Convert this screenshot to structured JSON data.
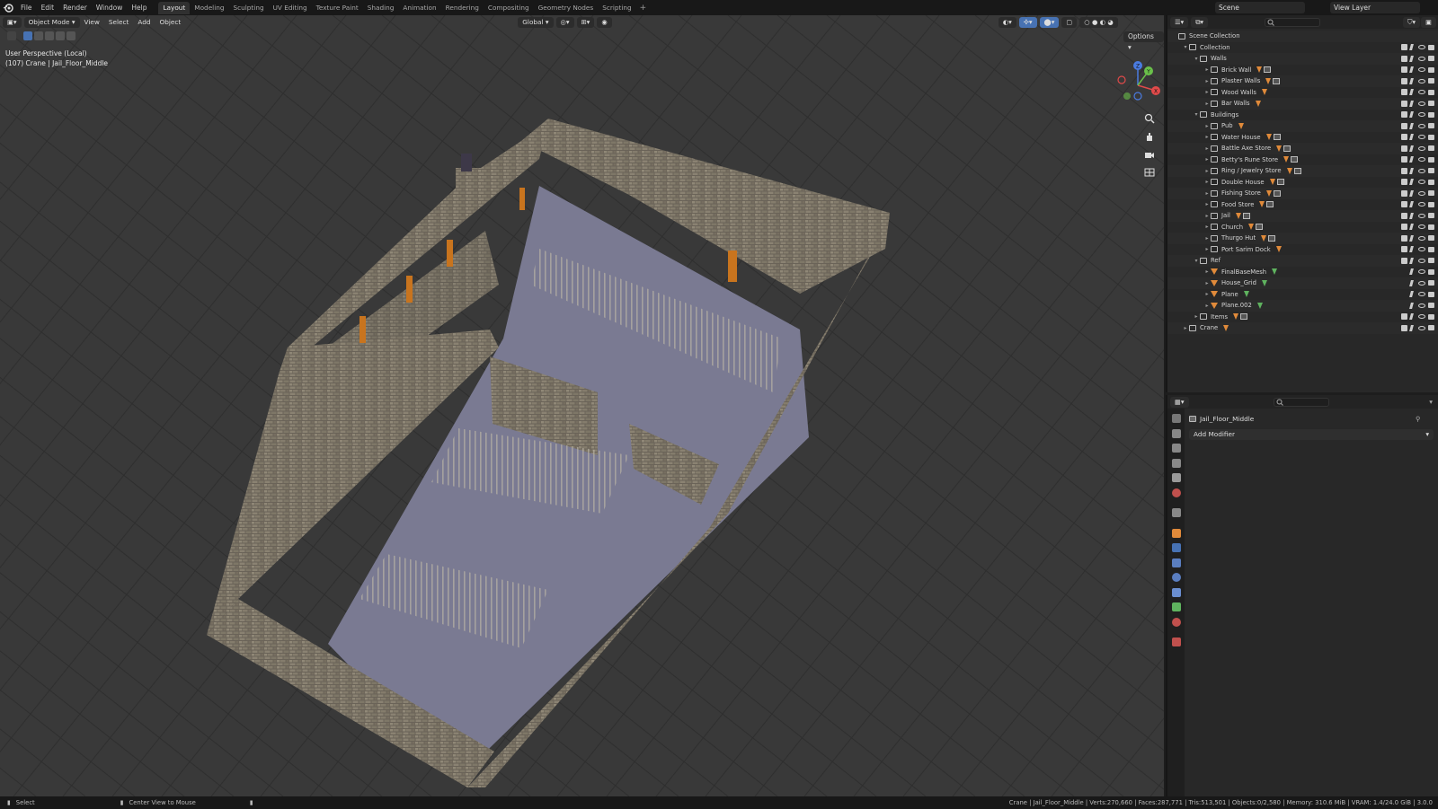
{
  "menu": [
    "File",
    "Edit",
    "Render",
    "Window",
    "Help"
  ],
  "workspaces": [
    "Layout",
    "Modeling",
    "Sculpting",
    "UV Editing",
    "Texture Paint",
    "Shading",
    "Animation",
    "Rendering",
    "Compositing",
    "Geometry Nodes",
    "Scripting"
  ],
  "active_workspace": "Layout",
  "scene_name": "Scene",
  "view_layer": "View Layer",
  "viewport": {
    "mode": "Object Mode",
    "menus": [
      "View",
      "Select",
      "Add",
      "Object"
    ],
    "transform_orientation": "Global",
    "options": "Options",
    "perspective": "User Perspective (Local)",
    "active_object": "(107) Crane | Jail_Floor_Middle",
    "gizmo_axes": {
      "z": "Z",
      "y": "Y",
      "x": "X"
    }
  },
  "outliner": {
    "root": "Scene Collection",
    "rows": [
      {
        "label": "Collection",
        "depth": 1,
        "kind": "collection",
        "open": true,
        "badges": [],
        "checkbox": true
      },
      {
        "label": "Walls",
        "depth": 2,
        "kind": "collection",
        "open": true,
        "badges": [],
        "checkbox": true
      },
      {
        "label": "Brick Wall",
        "depth": 3,
        "kind": "collection",
        "open": false,
        "badges": [
          "orange",
          "img"
        ],
        "checkbox": true
      },
      {
        "label": "Plaster Walls",
        "depth": 3,
        "kind": "collection",
        "open": false,
        "badges": [
          "orange",
          "img"
        ],
        "checkbox": true
      },
      {
        "label": "Wood Walls",
        "depth": 3,
        "kind": "collection",
        "open": false,
        "badges": [
          "orange"
        ],
        "checkbox": true
      },
      {
        "label": "Bar Walls",
        "depth": 3,
        "kind": "collection",
        "open": false,
        "badges": [
          "orange"
        ],
        "checkbox": true
      },
      {
        "label": "Buildings",
        "depth": 2,
        "kind": "collection",
        "open": true,
        "badges": [],
        "checkbox": true
      },
      {
        "label": "Pub",
        "depth": 3,
        "kind": "collection",
        "open": false,
        "badges": [
          "orange"
        ],
        "checkbox": true
      },
      {
        "label": "Water House",
        "depth": 3,
        "kind": "collection",
        "open": false,
        "badges": [
          "orange",
          "img"
        ],
        "checkbox": true
      },
      {
        "label": "Battle Axe Store",
        "depth": 3,
        "kind": "collection",
        "open": false,
        "badges": [
          "orange",
          "img"
        ],
        "checkbox": true
      },
      {
        "label": "Betty's Rune Store",
        "depth": 3,
        "kind": "collection",
        "open": false,
        "badges": [
          "orange",
          "img"
        ],
        "checkbox": true
      },
      {
        "label": "Ring / Jewelry Store",
        "depth": 3,
        "kind": "collection",
        "open": false,
        "badges": [
          "orange",
          "img"
        ],
        "checkbox": true
      },
      {
        "label": "Double House",
        "depth": 3,
        "kind": "collection",
        "open": false,
        "badges": [
          "orange",
          "img"
        ],
        "checkbox": true
      },
      {
        "label": "Fishing Store",
        "depth": 3,
        "kind": "collection",
        "open": false,
        "badges": [
          "orange",
          "img"
        ],
        "checkbox": true
      },
      {
        "label": "Food Store",
        "depth": 3,
        "kind": "collection",
        "open": false,
        "badges": [
          "orange",
          "img"
        ],
        "checkbox": true
      },
      {
        "label": "Jail",
        "depth": 3,
        "kind": "collection",
        "open": false,
        "badges": [
          "orange",
          "img"
        ],
        "checkbox": true
      },
      {
        "label": "Church",
        "depth": 3,
        "kind": "collection",
        "open": false,
        "badges": [
          "orange",
          "img"
        ],
        "checkbox": true
      },
      {
        "label": "Thurgo Hut",
        "depth": 3,
        "kind": "collection",
        "open": false,
        "badges": [
          "orange",
          "img"
        ],
        "checkbox": true
      },
      {
        "label": "Port Sarim Dock",
        "depth": 3,
        "kind": "collection",
        "open": false,
        "badges": [
          "orange"
        ],
        "checkbox": true
      },
      {
        "label": "Ref",
        "depth": 2,
        "kind": "collection",
        "open": true,
        "badges": [],
        "checkbox": true
      },
      {
        "label": "FinalBaseMesh",
        "depth": 3,
        "kind": "mesh",
        "open": false,
        "badges": [
          "green"
        ],
        "checkbox": false
      },
      {
        "label": "House_Grid",
        "depth": 3,
        "kind": "mesh",
        "open": false,
        "badges": [
          "green"
        ],
        "checkbox": false
      },
      {
        "label": "Plane",
        "depth": 3,
        "kind": "mesh",
        "open": false,
        "badges": [
          "green"
        ],
        "checkbox": false
      },
      {
        "label": "Plane.002",
        "depth": 3,
        "kind": "mesh",
        "open": false,
        "badges": [
          "green"
        ],
        "checkbox": false
      },
      {
        "label": "Items",
        "depth": 2,
        "kind": "collection",
        "open": false,
        "badges": [
          "orange",
          "img"
        ],
        "checkbox": true
      },
      {
        "label": "Crane",
        "depth": 1,
        "kind": "collection",
        "open": false,
        "badges": [
          "orange"
        ],
        "checkbox": true
      }
    ]
  },
  "properties": {
    "object_name": "Jail_Floor_Middle",
    "add_modifier": "Add Modifier"
  },
  "status": {
    "left_action": "Select",
    "mid_action": "Center View to Mouse",
    "stats": "Crane | Jail_Floor_Middle | Verts:270,660 | Faces:287,771 | Tris:513,501 | Objects:0/2,580 | Memory: 310.6 MiB | VRAM: 1.4/24.0 GiB | 3.0.0"
  },
  "colors": {
    "accent": "#4772b3",
    "mesh_orange": "#e08a3a",
    "mesh_green": "#5fb35f",
    "floor": "#7a7a92"
  }
}
